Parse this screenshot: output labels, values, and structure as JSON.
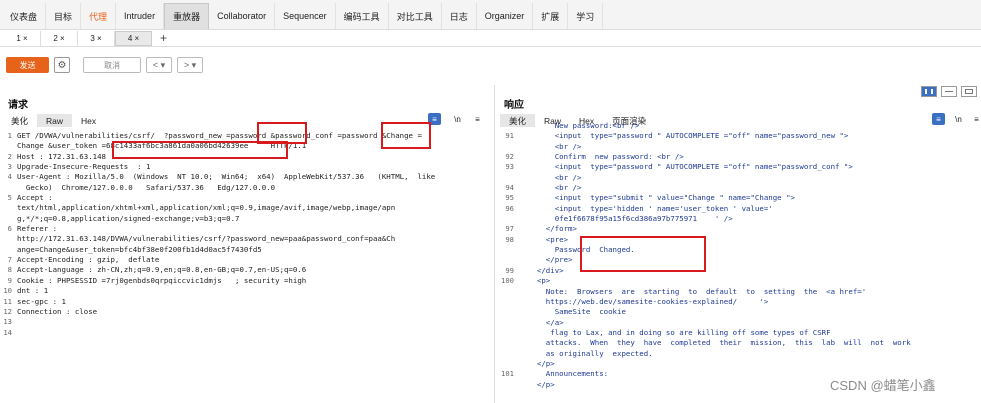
{
  "topnav": [
    "仪表盘",
    "目标",
    "代理",
    "Intruder",
    "重放器",
    "Collaborator",
    "Sequencer",
    "编码工具",
    "对比工具",
    "日志",
    "Organizer",
    "扩展",
    "学习"
  ],
  "subtabs": [
    "1 ×",
    "2 ×",
    "3 ×",
    "4 ×"
  ],
  "toolbar": {
    "send": "发送",
    "cancel": "取消",
    "prev": "< ▾",
    "next": "> ▾"
  },
  "request": {
    "title": "请求",
    "tabs": [
      "美化",
      "Raw",
      "Hex"
    ],
    "line_numbers": "1\n\n2\n3\n4\n\n5\n\n\n6\n\n\n7\n8\n9\n10\n11\n12\n13\n14",
    "code": "GET /DVWA/vulnerabilities/csrf/  ?password_new =password &password_conf =password &Change =\nChange &user_token =68c1433af6bc3a861da0a06bd42639ee     HTTP/1.1\nHost : 172.31.63.148\nUpgrade-Insecure-Requests  : 1\nUser-Agent : Mozilla/5.0  (Windows  NT 10.0;  Win64;  x64)  AppleWebKit/537.36   (KHTML,  like\n  Gecko)  Chrome/127.0.0.0   Safari/537.36   Edg/127.0.0.0\nAccept :\ntext/html,application/xhtml+xml,application/xml;q=0.9,image/avif,image/webp,image/apn\ng,*/*;q=0.8,application/signed-exchange;v=b3;q=0.7\nReferer :\nhttp://172.31.63.148/DVWA/vulnerabilities/csrf/?password_new=paa&password_conf=paa&Ch\nange=Change&user_token=bfc4bf38e0f200fb1d4d0ac5f7430fd5\nAccept-Encoding : gzip,  deflate\nAccept-Language : zh-CN,zh;q=0.9,en;q=0.8,en-GB;q=0.7,en-US;q=0.6\nCookie : PHPSESSID =7rj0genbds0qrpqiccvic1dmjs   ; security =high\ndnt : 1\nsec-gpc : 1\nConnection : close"
  },
  "response": {
    "title": "响应",
    "tabs": [
      "美化",
      "Raw",
      "Hex",
      "页面渲染"
    ],
    "line_numbers": "\n91\n\n92\n93\n\n94\n95\n96\n\n97\n98\n\n\n99\n100\n\n\n\n\n\n\n\n\n101",
    "code": "      New password:<br />\n      <input  type=\"password \" AUTOCOMPLETE =\"off\" name=\"password_new \">\n      <br />\n      Confirm  new password: <br />\n      <input  type=\"password \" AUTOCOMPLETE =\"off\" name=\"password_conf \">\n      <br />\n      <br />\n      <input  type=\"submit \" value=\"Change \" name=\"Change \">\n      <input  type='hidden ' name='user_token ' value='\n      0fe1f6678f95a15f6cd386a97b775971    ' />\n    </form>\n    <pre>\n      Password  Changed.\n    </pre>\n  </div>\n  <p>\n    Note:  Browsers  are  starting  to  default  to  setting  the  <a href='\n    https://web.dev/samesite-cookies-explained/     '>\n      SameSite  cookie\n    </a>\n     flag to Lax, and in doing so are killing off some types of CSRF\n    attacks.  When  they  have  completed  their  mission,  this  lab  will  not  work\n    as originally  expected.\n  </p>\n    Announcements:\n  </p>"
  },
  "watermark": "CSDN @蜡笔小鑫"
}
